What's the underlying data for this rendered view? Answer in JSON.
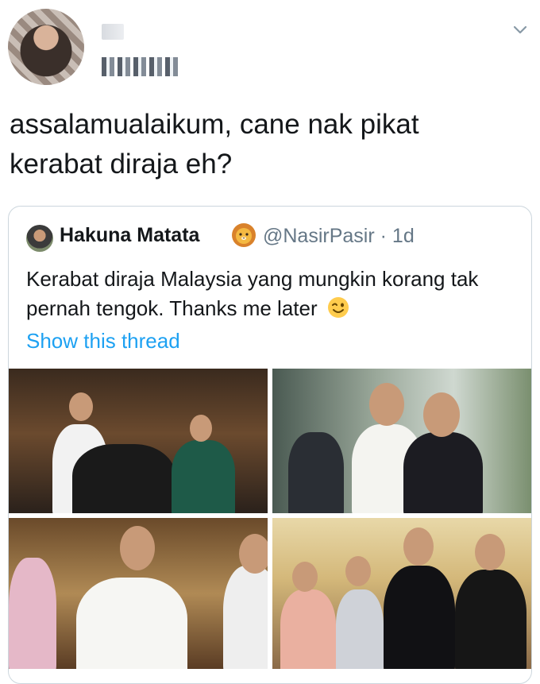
{
  "tweet": {
    "text": "assalamualaikum, cane nak pikat\nkerabat diraja eh?"
  },
  "quoted_tweet": {
    "display_name": "Hakuna Matata",
    "emoji": "lion-face-emoji",
    "handle": "@NasirPasir",
    "time": "· 1d",
    "text": "Kerabat diraja Malaysia yang mungkin korang tak pernah tengok. Thanks me later",
    "text_emoji": "winking-face-emoji",
    "link_label": "Show this thread"
  },
  "colors": {
    "link": "#1da1f2",
    "secondary_text": "#657786",
    "border": "#ccd6dd"
  }
}
